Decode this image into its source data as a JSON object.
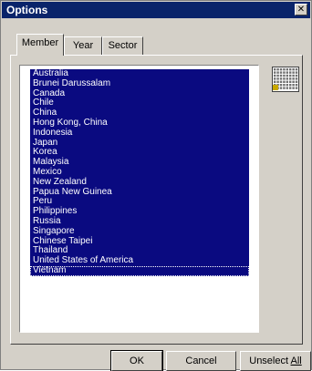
{
  "window": {
    "title": "Options",
    "close_glyph": "✕"
  },
  "tabs": [
    {
      "label": "Member",
      "active": true
    },
    {
      "label": "Year",
      "active": false
    },
    {
      "label": "Sector",
      "active": false
    }
  ],
  "member_list": {
    "items": [
      "Australia",
      "Brunei Darussalam",
      "Canada",
      "Chile",
      "China",
      "Hong Kong, China",
      "Indonesia",
      "Japan",
      "Korea",
      "Malaysia",
      "Mexico",
      "New Zealand",
      "Papua New Guinea",
      "Peru",
      "Philippines",
      "Russia",
      "Singapore",
      "Chinese Taipei",
      "Thailand",
      "United States of America",
      "Vietnam"
    ],
    "selection_color": "#0a0a80",
    "focused_item": "Vietnam"
  },
  "grid_icon": {
    "name": "grid-icon",
    "accent": "#c8a800"
  },
  "buttons": {
    "ok": "OK",
    "cancel": "Cancel",
    "unselect_prefix": "Unselect ",
    "unselect_underlined": "All"
  },
  "colors": {
    "titlebar": "#0a246a",
    "face": "#d4d0c8"
  }
}
